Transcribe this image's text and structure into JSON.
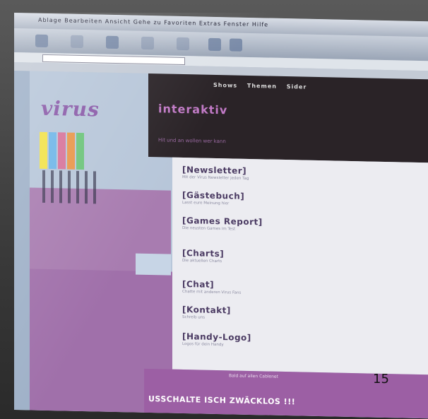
{
  "page_number": "15",
  "site": {
    "logo": "virus",
    "nav": [
      "Shows",
      "Themen",
      "Sider"
    ],
    "section_title": "interaktiv",
    "section_sub": "Hit und an wollen wer kann"
  },
  "menu": [
    {
      "title": "[Newsletter]",
      "desc": "Mit der Virus Newsletter jeden Tag"
    },
    {
      "title": "[Gästebuch]",
      "desc": "Lasst eure Meinung hier"
    },
    {
      "title": "[Games Report]",
      "desc": "Die neusten Games im Test"
    },
    {
      "title": "[Charts]",
      "desc": "Die aktuellen Charts"
    },
    {
      "title": "[Chat]",
      "desc": "Chatte mit anderen Virus Fans"
    },
    {
      "title": "[Kontakt]",
      "desc": "Schreib uns"
    },
    {
      "title": "[Handy-Logo]",
      "desc": "Logos für dein Handy"
    }
  ],
  "footer": {
    "top": "Bald auf allen Cablenet",
    "main": "USSCHALTE ISCH ZWÄCKLOS !!!"
  },
  "colors": {
    "purple": "#a87cb0",
    "dark": "#2a2327",
    "cat_colors": [
      "#f2e24a",
      "#6fb6e8",
      "#d7739a",
      "#e8964a",
      "#6cc47a"
    ]
  }
}
